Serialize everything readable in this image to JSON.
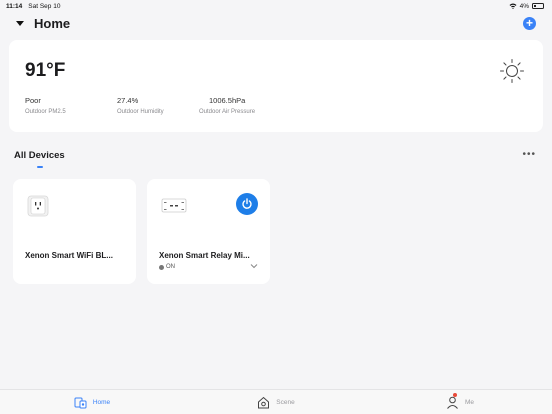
{
  "status_bar": {
    "time": "11:14",
    "date": "Sat Sep 10",
    "battery": "4%"
  },
  "header": {
    "title": "Home",
    "add_icon": "plus-icon"
  },
  "weather": {
    "temperature": "91°F",
    "metrics": [
      {
        "value": "Poor",
        "label": "Outdoor PM2.5"
      },
      {
        "value": "27.4%",
        "label": "Outdoor Humidity"
      },
      {
        "value": "1006.5hPa",
        "label": "Outdoor Air Pressure"
      }
    ],
    "icon": "sun-icon"
  },
  "devices_section": {
    "title": "All Devices",
    "more": "•••"
  },
  "devices": [
    {
      "name": "Xenon Smart WiFi BL...",
      "icon": "smart-plug-icon"
    },
    {
      "name": "Xenon Smart Relay Mi...",
      "icon": "relay-module-icon",
      "status": "ON",
      "power_icon": "power-icon"
    }
  ],
  "tabs": [
    {
      "label": "Home",
      "icon": "home-devices-icon",
      "active": true
    },
    {
      "label": "Scene",
      "icon": "scene-house-icon",
      "active": false
    },
    {
      "label": "Me",
      "icon": "person-icon",
      "active": false,
      "notification": true
    }
  ],
  "colors": {
    "accent": "#3a82f7",
    "power_button": "#1e7ee8",
    "notification": "#e84a3a",
    "background": "#f5f5f7"
  }
}
